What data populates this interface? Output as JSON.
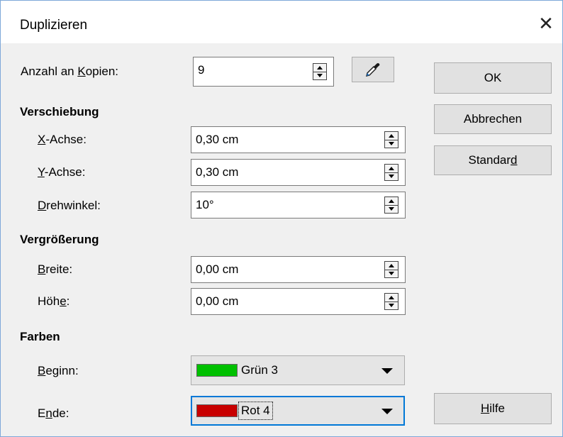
{
  "dialog": {
    "title": "Duplizieren",
    "close_symbol": "✕"
  },
  "copies": {
    "label_pre": "Anzahl an ",
    "label_u": "K",
    "label_post": "opien:",
    "value": "9"
  },
  "offset": {
    "heading": "Verschiebung",
    "x_axis": {
      "label_u": "X",
      "label_post": "-Achse:",
      "value": "0,30 cm"
    },
    "y_axis": {
      "label_u": "Y",
      "label_post": "-Achse:",
      "value": "0,30 cm"
    },
    "angle": {
      "label_u": "D",
      "label_post": "rehwinkel:",
      "value": "10°"
    }
  },
  "enlargement": {
    "heading": "Vergrößerung",
    "width": {
      "label_u": "B",
      "label_post": "reite:",
      "value": "0,00 cm"
    },
    "height": {
      "label_pre": "Höh",
      "label_u": "e",
      "label_post": ":",
      "value": "0,00 cm"
    }
  },
  "colors": {
    "heading": "Farben",
    "start": {
      "label_u": "B",
      "label_post": "eginn:",
      "value": "Grün 3",
      "swatch": "#00c000"
    },
    "end": {
      "label_pre": "E",
      "label_u": "n",
      "label_post": "de:",
      "value": "Rot 4",
      "swatch": "#c80000"
    }
  },
  "buttons": {
    "ok": "OK",
    "cancel": "Abbrechen",
    "default_pre": "Standar",
    "default_u": "d",
    "help_u": "H",
    "help_post": "ilfe"
  },
  "icons": {
    "close": "close-icon",
    "pipette": "pipette-icon",
    "spin_up": "spin-up-icon",
    "spin_down": "spin-down-icon",
    "dropdown": "chevron-down-icon"
  },
  "theme": {
    "focus_color": "#0078d7",
    "dialog_bg": "#f0f0f0"
  }
}
